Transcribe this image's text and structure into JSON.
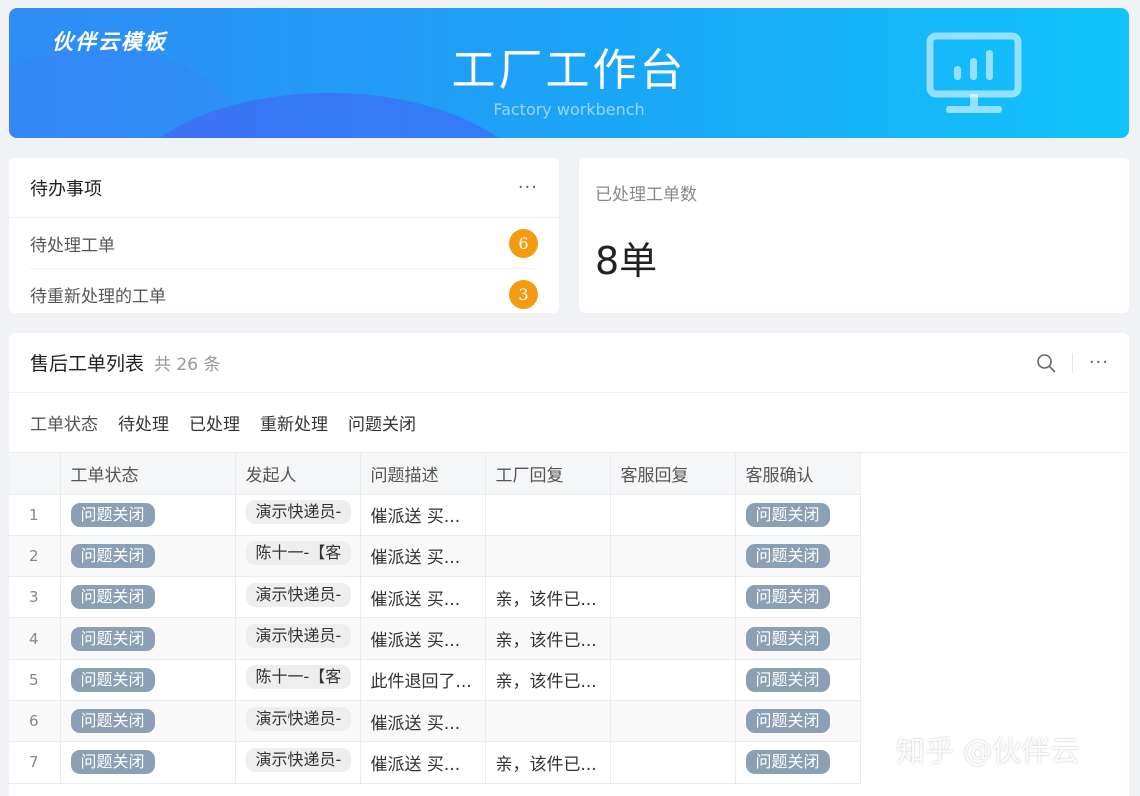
{
  "banner": {
    "brand": "伙伴云模板",
    "title": "工厂工作台",
    "subtitle": "Factory workbench",
    "icon": "monitor-chart-icon"
  },
  "todo": {
    "title": "待办事项",
    "more": "···",
    "items": [
      {
        "label": "待处理工单",
        "count": "6"
      },
      {
        "label": "待重新处理的工单",
        "count": "3"
      }
    ]
  },
  "stat": {
    "label": "已处理工单数",
    "value": "8单"
  },
  "list": {
    "title": "售后工单列表",
    "count": "共 26 条",
    "more": "···",
    "filters": {
      "label": "工单状态",
      "options": [
        "待处理",
        "已处理",
        "重新处理",
        "问题关闭"
      ]
    },
    "columns": [
      "工单状态",
      "发起人",
      "问题描述",
      "工厂回复",
      "客服回复",
      "客服确认"
    ],
    "rows": [
      {
        "idx": "1",
        "status": "问题关闭",
        "initiator": "演示快递员-",
        "desc": "催派送 买...",
        "factory": "",
        "cs": "",
        "confirm": "问题关闭"
      },
      {
        "idx": "2",
        "status": "问题关闭",
        "initiator": "陈十一-【客",
        "desc": "催派送 买...",
        "factory": "",
        "cs": "",
        "confirm": "问题关闭"
      },
      {
        "idx": "3",
        "status": "问题关闭",
        "initiator": "演示快递员-",
        "desc": "催派送 买...",
        "factory": "亲，该件已...",
        "cs": "",
        "confirm": "问题关闭"
      },
      {
        "idx": "4",
        "status": "问题关闭",
        "initiator": "演示快递员-",
        "desc": "催派送 买...",
        "factory": "亲，该件已...",
        "cs": "",
        "confirm": "问题关闭"
      },
      {
        "idx": "5",
        "status": "问题关闭",
        "initiator": "陈十一-【客",
        "desc": "此件退回了...",
        "factory": "亲，该件已...",
        "cs": "",
        "confirm": "问题关闭"
      },
      {
        "idx": "6",
        "status": "问题关闭",
        "initiator": "演示快递员-",
        "desc": "催派送 买...",
        "factory": "",
        "cs": "",
        "confirm": "问题关闭"
      },
      {
        "idx": "7",
        "status": "问题关闭",
        "initiator": "演示快递员-",
        "desc": "催派送 买...",
        "factory": "亲，该件已...",
        "cs": "",
        "confirm": "问题关闭"
      }
    ]
  },
  "watermark": "知乎 @伙伴云",
  "colors": {
    "badge": "#f39c12",
    "pill": "#8b9fb5",
    "banner_start": "#2f8cf6",
    "banner_end": "#12c4fb"
  }
}
